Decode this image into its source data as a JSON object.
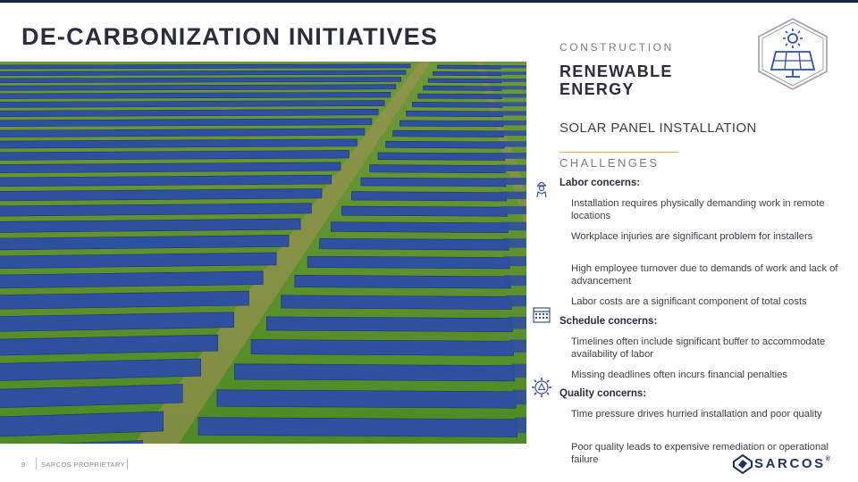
{
  "slide": {
    "title": "DE-CARBONIZATION INITIATIVES",
    "page_number": "9",
    "proprietary": "SARCOS PROPRIETARY"
  },
  "panel": {
    "eyebrow": "CONSTRUCTION",
    "sub_title": "RENEWABLE ENERGY",
    "topic": "SOLAR PANEL INSTALLATION",
    "challenges_label": "CHALLENGES",
    "badge_icon": "solar-panel-icon"
  },
  "concerns": [
    {
      "heading": "Labor concerns:",
      "icon": "worker-icon",
      "items": [
        "Installation requires physically demanding work in remote locations",
        "Workplace injuries are  significant problem for installers",
        "High employee turnover due to demands of work and lack of advancement",
        "Labor costs are a significant component of total costs"
      ]
    },
    {
      "heading": "Schedule concerns:",
      "icon": "calendar-icon",
      "items": [
        "Timelines often include significant buffer to accommodate availability of labor",
        "Missing deadlines often incurs financial penalties"
      ]
    },
    {
      "heading": "Quality concerns:",
      "icon": "quality-gear-icon",
      "items": [
        "Time pressure drives hurried installation and poor quality",
        "Poor quality leads to expensive remediation or operational failure"
      ]
    }
  ],
  "logo": {
    "text": "SARCOS",
    "mark": "®"
  },
  "colors": {
    "navy": "#1b2140",
    "accent": "#e9a45b",
    "panel_blue": "#2f4fa0",
    "grass": "#5a8d2c"
  }
}
